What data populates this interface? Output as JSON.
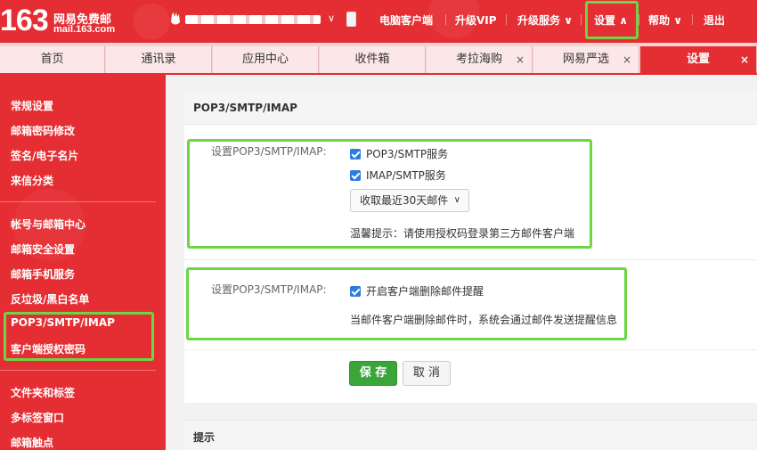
{
  "header": {
    "logo_number": "163",
    "logo_name": "网易免费邮",
    "logo_domain": "mail.163.com",
    "user_chevron": "∨",
    "nav": {
      "client": "电脑客户端",
      "vip": "升级VIP",
      "upgrade": "升级服务",
      "settings": "设置",
      "help": "帮助",
      "logout": "退出"
    }
  },
  "tabs": [
    {
      "label": "首页",
      "close": ""
    },
    {
      "label": "通讯录",
      "close": ""
    },
    {
      "label": "应用中心",
      "close": ""
    },
    {
      "label": "收件箱",
      "close": ""
    },
    {
      "label": "考拉海购",
      "close": "×"
    },
    {
      "label": "网易严选",
      "close": "×"
    },
    {
      "label": "设置",
      "close": "×"
    }
  ],
  "sidebar": {
    "items": [
      "常规设置",
      "邮箱密码修改",
      "签名/电子名片",
      "来信分类",
      "帐号与邮箱中心",
      "邮箱安全设置",
      "邮箱手机服务",
      "反垃圾/黑白名单",
      "POP3/SMTP/IMAP",
      "客户端授权密码",
      "文件夹和标签",
      "多标签窗口",
      "邮箱触点"
    ]
  },
  "main": {
    "title": "POP3/SMTP/IMAP",
    "section1": {
      "label": "设置POP3/SMTP/IMAP:",
      "pop3": "POP3/SMTP服务",
      "imap": "IMAP/SMTP服务",
      "dropdown": "收取最近30天邮件",
      "tip": "温馨提示：请使用授权码登录第三方邮件客户端"
    },
    "section2": {
      "label": "设置POP3/SMTP/IMAP:",
      "delete_alert": "开启客户端删除邮件提醒",
      "description": "当邮件客户端删除邮件时，系统会通过邮件发送提醒信息"
    },
    "save": "保 存",
    "cancel": "取 消",
    "tips_title": "提示"
  },
  "colors": {
    "brand_red": "#e52e33",
    "highlight_green": "#6cd643",
    "checkbox_blue": "#2a7ce0",
    "save_green": "#3aa63a"
  }
}
